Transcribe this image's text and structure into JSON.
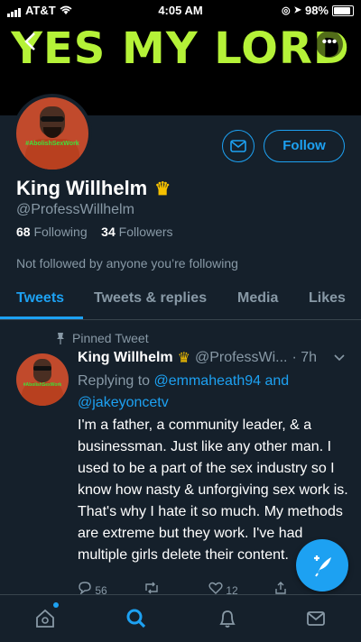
{
  "status_bar": {
    "carrier": "AT&T",
    "time": "4:05 AM",
    "battery": "98%"
  },
  "header": {
    "banner_text": "YES MY LORD",
    "avatar_tag": "#AbolishSexWork"
  },
  "profile": {
    "follow_label": "Follow",
    "name": "King Willhelm",
    "handle": "@ProfessWillhelm",
    "following_count": "68",
    "following_label": "Following",
    "followers_count": "34",
    "followers_label": "Followers",
    "not_followed_text": "Not followed by anyone you’re following"
  },
  "tabs": [
    {
      "label": "Tweets",
      "active": true
    },
    {
      "label": "Tweets & replies"
    },
    {
      "label": "Media"
    },
    {
      "label": "Likes"
    }
  ],
  "tweet": {
    "pinned_label": "Pinned Tweet",
    "author_name": "King Willhelm",
    "author_handle": "@ProfessWi...",
    "time": "· 7h",
    "replying_to": "Replying to",
    "mention1": "@emmaheath94",
    "and": "and",
    "mention2": "@jakeyoncetv",
    "text": "I'm a father, a community leader, & a businessman. Just like any other man. I used to be a part of the sex industry so I know how nasty & unforgiving sex work is. That's why I hate it so much. My methods are extreme but they work. I've had multiple girls delete their content.",
    "reply_count": "56",
    "like_count": "12"
  },
  "colors": {
    "accent": "#1da1f2",
    "banner_text": "#b5f238",
    "background": "#15202b"
  },
  "icons": [
    "back-icon",
    "more-icon",
    "mail-icon",
    "pin-icon",
    "crown-icon",
    "chevron-down-icon",
    "reply-icon",
    "retweet-icon",
    "like-icon",
    "share-icon",
    "compose-icon",
    "home-icon",
    "search-icon",
    "notifications-icon",
    "messages-icon"
  ]
}
